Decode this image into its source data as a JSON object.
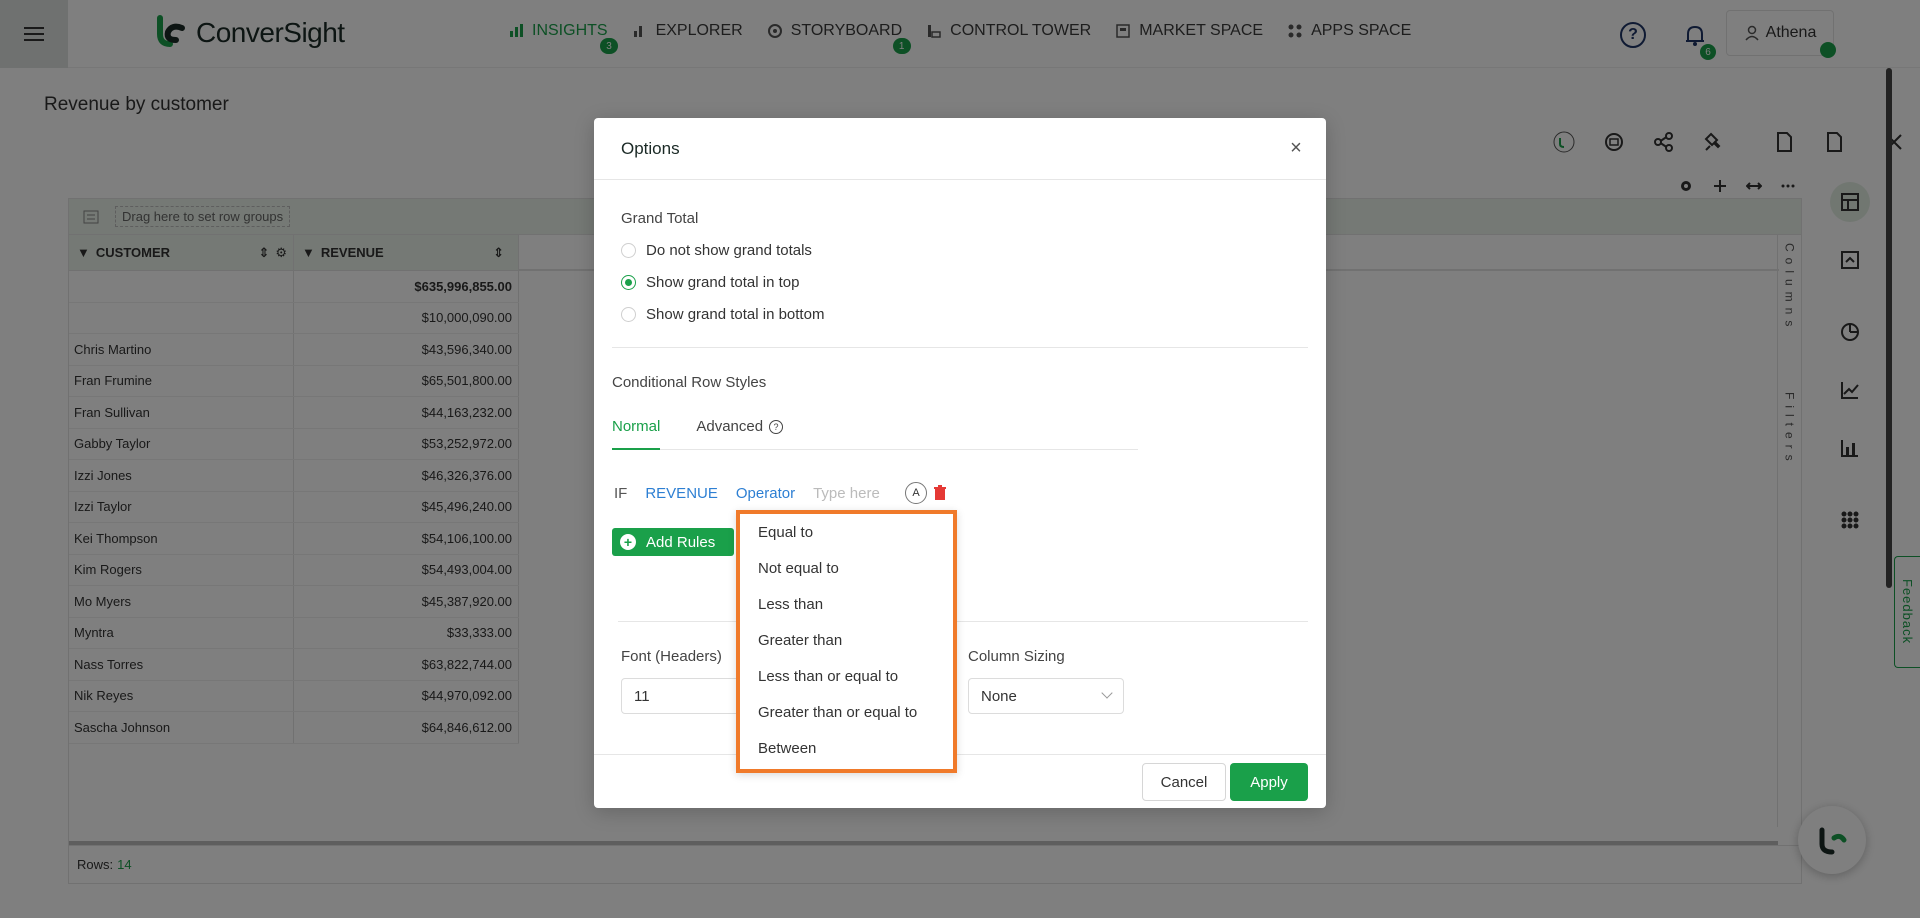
{
  "app": {
    "logo_text": "ConverSight",
    "nav": [
      {
        "label": "INSIGHTS",
        "badge": "3",
        "active": true
      },
      {
        "label": "EXPLORER",
        "badge": ""
      },
      {
        "label": "STORYBOARD",
        "badge": "1"
      },
      {
        "label": "CONTROL TOWER",
        "badge": ""
      },
      {
        "label": "MARKET SPACE",
        "badge": ""
      },
      {
        "label": "APPS SPACE",
        "badge": ""
      }
    ],
    "notifications_badge": "6",
    "user_name": "Athena",
    "accent_color": "#1aa04a"
  },
  "page": {
    "title": "Revenue by customer"
  },
  "grid": {
    "group_placeholder": "Drag here to set row groups",
    "columns": [
      "CUSTOMER",
      "REVENUE"
    ],
    "rows": [
      {
        "customer": "",
        "revenue": "$635,996,855.00",
        "total": true
      },
      {
        "customer": "",
        "revenue": "$10,000,090.00"
      },
      {
        "customer": "Chris Martino",
        "revenue": "$43,596,340.00"
      },
      {
        "customer": "Fran Frumine",
        "revenue": "$65,501,800.00"
      },
      {
        "customer": "Fran Sullivan",
        "revenue": "$44,163,232.00"
      },
      {
        "customer": "Gabby Taylor",
        "revenue": "$53,252,972.00"
      },
      {
        "customer": "Izzi Jones",
        "revenue": "$46,326,376.00"
      },
      {
        "customer": "Izzi Taylor",
        "revenue": "$45,496,240.00"
      },
      {
        "customer": "Kei Thompson",
        "revenue": "$54,106,100.00"
      },
      {
        "customer": "Kim Rogers",
        "revenue": "$54,493,004.00"
      },
      {
        "customer": "Mo Myers",
        "revenue": "$45,387,920.00"
      },
      {
        "customer": "Myntra",
        "revenue": "$33,333.00"
      },
      {
        "customer": "Nass Torres",
        "revenue": "$63,822,744.00"
      },
      {
        "customer": "Nik Reyes",
        "revenue": "$44,970,092.00"
      },
      {
        "customer": "Sascha Johnson",
        "revenue": "$64,846,612.00"
      }
    ],
    "side_columns_label": "Columns",
    "side_filters_label": "Filters",
    "rows_label": "Rows:",
    "rows_count": "14"
  },
  "feedback_label": "Feedback",
  "modal": {
    "title": "Options",
    "grand_total": {
      "title": "Grand Total",
      "options": [
        {
          "label": "Do not show grand totals",
          "checked": false
        },
        {
          "label": "Show grand total in top",
          "checked": true
        },
        {
          "label": "Show grand total in bottom",
          "checked": false
        }
      ]
    },
    "conditional": {
      "title": "Conditional Row Styles",
      "tab_normal": "Normal",
      "tab_advanced": "Advanced",
      "if_label": "IF",
      "field": "REVENUE",
      "operator": "Operator",
      "value_placeholder": "Type here",
      "case_label": "A",
      "add_rules": "Add Rules"
    },
    "font_headers_label": "Font (Headers)",
    "font_headers_value": "11",
    "column_sizing_label": "Column Sizing",
    "column_sizing_value": "None",
    "cancel": "Cancel",
    "apply": "Apply"
  },
  "operator_dropdown": [
    "Equal to",
    "Not equal to",
    "Less than",
    "Greater than",
    "Less than or equal to",
    "Greater than or equal to",
    "Between"
  ]
}
